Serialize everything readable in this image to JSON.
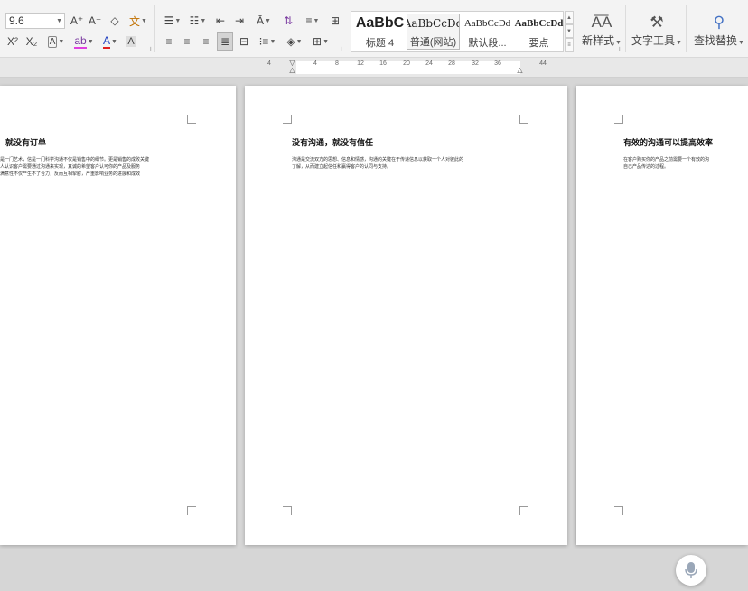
{
  "ribbon": {
    "font_size": "9.6",
    "font_group": {
      "grow_font": "A⁺",
      "shrink_font": "A⁻",
      "clear_format": "⌫",
      "phonetic": "文",
      "superscript": "X²",
      "subscript": "X₂",
      "char_shading": "A",
      "highlight": "ab",
      "font_color": "A",
      "char_border": "A"
    },
    "styles": [
      {
        "preview": "AaBbC",
        "label": "标题 4"
      },
      {
        "preview": "AaBbCcDd",
        "label": "普通(网站)"
      },
      {
        "preview": "AaBbCcDd",
        "label": "默认段..."
      },
      {
        "preview": "AaBbCcDd",
        "label": "要点"
      }
    ],
    "new_style": "新样式",
    "text_tools": "文字工具",
    "find_replace": "查找替换",
    "accent_color": "#4472c4"
  },
  "ruler": {
    "ticks": [
      "4",
      "4",
      "8",
      "12",
      "16",
      "20",
      "24",
      "28",
      "32",
      "36",
      "44"
    ]
  },
  "pages": [
    {
      "heading": "就没有订单",
      "body": "是一门艺术，信是一门科学沟通不仅是销售中的细节。更是销售的成败关键\n人认识客户需要通过沟通来实现，真诚的希望客户认可你的产品及服务\n满意性不仅产生不了合力，反而互相掣肘，严重影响业务的进展和成效"
    },
    {
      "heading": "没有沟通，就没有信任",
      "body": "沟通是交流双方的思想、信息和情感，沟通的关键在于传递信息以获取一个人对彼此的\n了解，从而建立起信任和赢得客户的认同与支持。"
    },
    {
      "heading": "有效的沟通可以提高效率",
      "body": "在客户购买你的产品之前需要一个有效的沟\n自己产品传达的过程。"
    }
  ]
}
